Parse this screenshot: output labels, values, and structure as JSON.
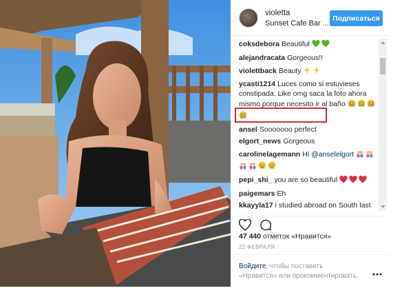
{
  "header": {
    "username": "violetta",
    "location": "Sunset Cafe Bar ...",
    "follow_label": "Подписаться"
  },
  "comments": [
    {
      "user": "coksdebora",
      "text": "Beautiful",
      "emoji": [
        "green-heart",
        "green-heart"
      ]
    },
    {
      "user": "alejandracata",
      "text": "Gorgeous!!",
      "emoji": []
    },
    {
      "user": "violettback",
      "text": "Beauty",
      "emoji": [
        "sparkles",
        "sparkles"
      ]
    },
    {
      "user": "ycasti1214",
      "text": "Luces como si estuvieses constipada. Like omg saca la foto ahora mismo porque necesito ir al baño",
      "emoji": [
        "crying-face",
        "crying-face",
        "crying-face",
        "crying-face"
      ]
    },
    {
      "user": "ansel",
      "text": "Sooooooo perfect",
      "emoji": []
    },
    {
      "user": "elgort_news",
      "text": "Gorgeous",
      "emoji": []
    },
    {
      "user": "carolinelagemann",
      "text": "Hi",
      "mention": "@anselelgort",
      "emoji": [
        "couple",
        "couple",
        "couple",
        "couple",
        "smiling-face",
        "smiling-face"
      ]
    },
    {
      "user": "pepi_shi_",
      "text": "you are so beautiful",
      "emoji": [
        "red-heart",
        "red-heart",
        "red-heart"
      ]
    },
    {
      "user": "paigemars",
      "text": "Eh",
      "emoji": []
    },
    {
      "user": "kkayyla17",
      "text": "i studied abroad on South last semester & we went to that cafe all the time for the wifi & a/c lol hope you enjoyed!",
      "emoji": []
    }
  ],
  "actions": {
    "like_icon": "heart-outline-icon",
    "comment_icon": "comment-bubble-icon"
  },
  "likes": {
    "count": "47 440",
    "label": "отметок «Нравится»"
  },
  "date": "22 ФЕВРАЛЯ",
  "footer": {
    "login_link": "Войдите",
    "text": ", чтобы поставить «Нравится» или прокомментировать."
  },
  "colors": {
    "accent": "#3897f0",
    "highlight": "#d62a2a",
    "link": "#003569"
  }
}
